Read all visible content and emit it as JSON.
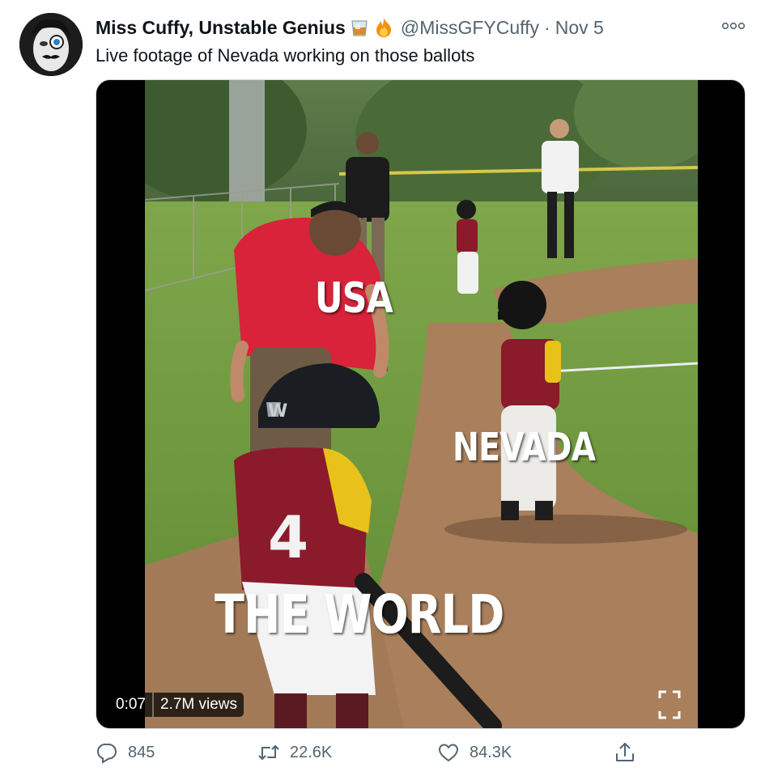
{
  "tweet": {
    "author_name": "Miss Cuffy, Unstable Genius",
    "name_emojis": [
      "tumbler-glass-icon",
      "fire-icon"
    ],
    "handle": "@MissGFYCuffy",
    "separator": "·",
    "date": "Nov 5",
    "text": "Live footage of Nevada working on those ballots"
  },
  "media": {
    "overlay_labels": {
      "usa": "USA",
      "nevada": "NEVADA",
      "world": "THE WORLD"
    },
    "jersey_number": "4",
    "duration": "0:07",
    "views": "2.7M views",
    "fullscreen_icon": "fullscreen-icon"
  },
  "actions": {
    "reply_count": "845",
    "retweet_count": "22.6K",
    "like_count": "84.3K",
    "icons": [
      "reply-icon",
      "retweet-icon",
      "like-icon",
      "share-icon"
    ]
  },
  "colors": {
    "text_primary": "#0f1419",
    "text_secondary": "#536471",
    "jersey_maroon": "#8b1a2b",
    "jersey_yellow": "#e8c21a",
    "coach_red": "#d8233a",
    "grass": "#6f9a3c",
    "dirt": "#a97f5c"
  }
}
